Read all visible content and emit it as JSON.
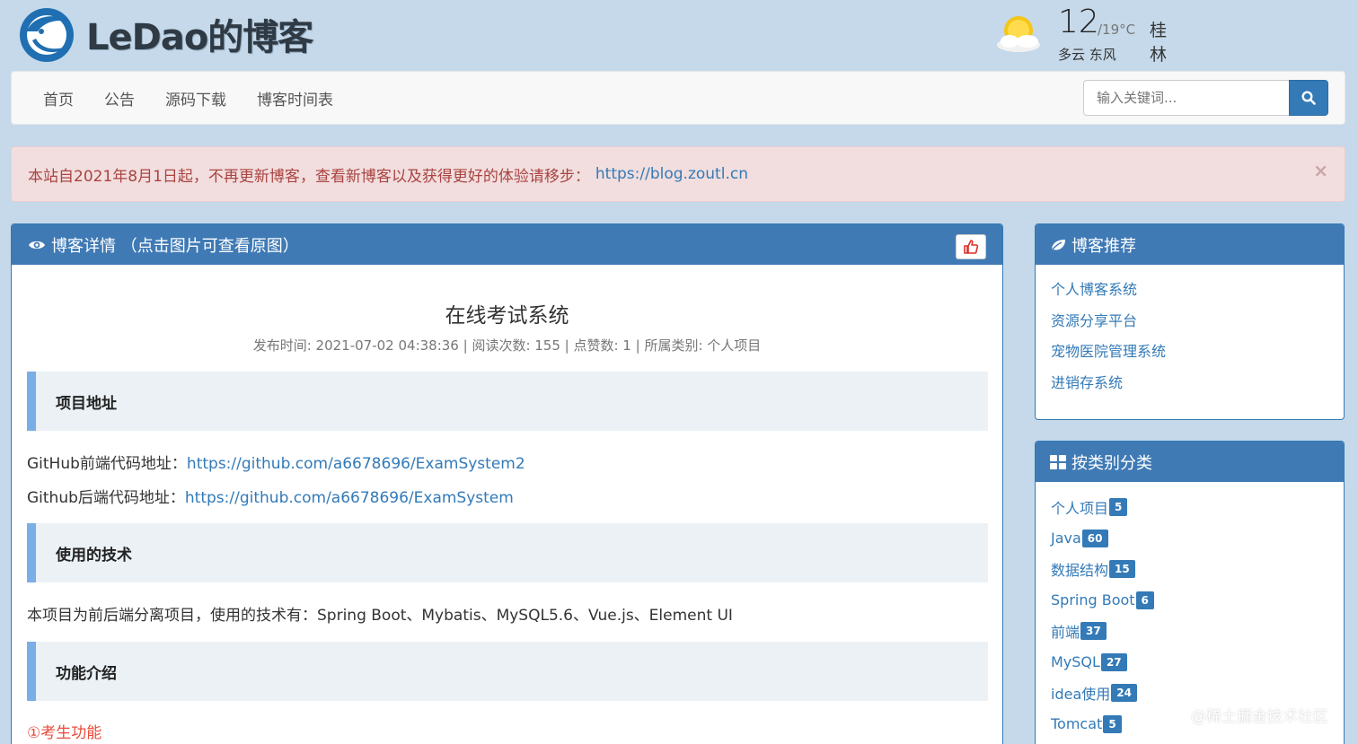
{
  "header": {
    "logo_text": "LeDao的博客",
    "weather": {
      "temp_now": "12",
      "temp_range": "/19°C",
      "city": "桂林",
      "condition": "多云 东风",
      "icon": "partly-cloudy-icon"
    }
  },
  "nav": {
    "items": [
      "首页",
      "公告",
      "源码下载",
      "博客时间表"
    ],
    "search_placeholder": "输入关键词...",
    "search_icon": "search-icon"
  },
  "alert": {
    "text": "本站自2021年8月1日起，不再更新博客，查看新博客以及获得更好的体验请移步：",
    "link": "https://blog.zoutl.cn",
    "close": "×"
  },
  "article": {
    "heading": "博客详情 （点击图片可查看原图）",
    "title": "在线考试系统",
    "meta": "发布时间: 2021-07-02 04:38:36 | 阅读次数: 155 | 点赞数: 1 | 所属类别: 个人项目",
    "sections": {
      "s1": "项目地址",
      "s2": "使用的技术",
      "s3": "功能介绍"
    },
    "github_front_label": "GitHub前端代码地址：",
    "github_front_url": "https://github.com/a6678696/ExamSystem2",
    "github_back_label": "Github后端代码地址：",
    "github_back_url": "https://github.com/a6678696/ExamSystem",
    "tech_text": "本项目为前后端分离项目，使用的技术有：Spring Boot、Mybatis、MySQL5.6、Vue.js、Element UI",
    "feature_1": "①考生功能"
  },
  "recommend": {
    "heading": "博客推荐",
    "items": [
      "个人博客系统",
      "资源分享平台",
      "宠物医院管理系统",
      "进销存系统"
    ]
  },
  "categories": {
    "heading": "按类别分类",
    "items": [
      {
        "name": "个人项目",
        "count": "5"
      },
      {
        "name": "Java",
        "count": "60"
      },
      {
        "name": "数据结构",
        "count": "15"
      },
      {
        "name": "Spring Boot",
        "count": "6"
      },
      {
        "name": "前端",
        "count": "37"
      },
      {
        "name": "MySQL",
        "count": "27"
      },
      {
        "name": "idea使用",
        "count": "24"
      },
      {
        "name": "Tomcat",
        "count": "5"
      }
    ]
  },
  "watermark": "@稀土掘金技术社区",
  "colors": {
    "background": "#c5d9ea",
    "primary": "#337ab7",
    "panel_heading": "#3f7ab5",
    "alert_bg": "#f2dede",
    "alert_text": "#a94442",
    "section_border": "#7aaee6"
  }
}
